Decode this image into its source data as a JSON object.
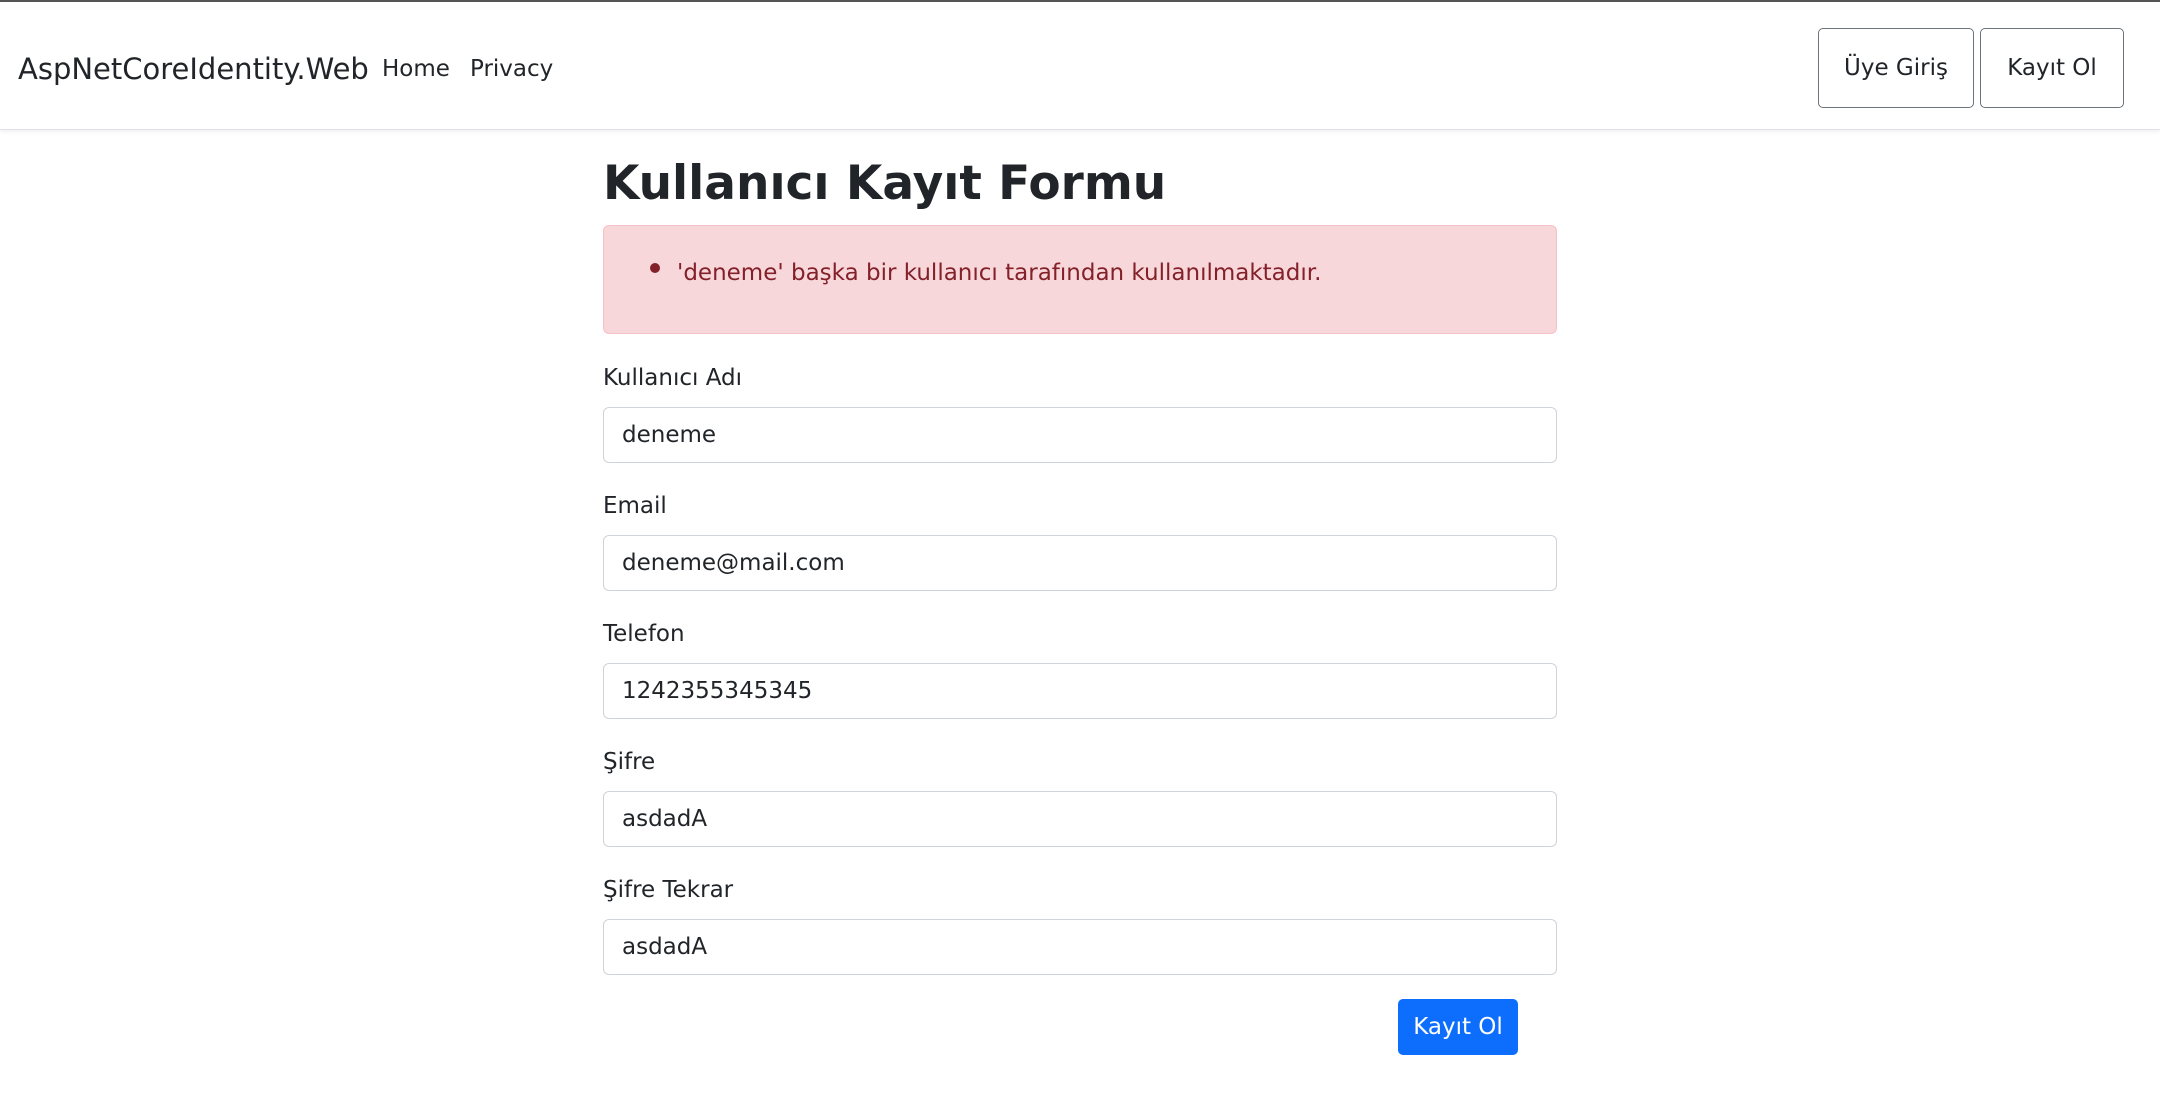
{
  "navbar": {
    "brand": "AspNetCoreIdentity.Web",
    "links": [
      {
        "label": "Home"
      },
      {
        "label": "Privacy"
      }
    ],
    "login_button": "Üye Giriş",
    "register_button": "Kayıt Ol"
  },
  "form": {
    "title": "Kullanıcı Kayıt Formu",
    "errors": [
      "'deneme' başka bir kullanıcı tarafından kullanılmaktadır."
    ],
    "fields": [
      {
        "label": "Kullanıcı Adı",
        "value": "deneme"
      },
      {
        "label": "Email",
        "value": "deneme@mail.com"
      },
      {
        "label": "Telefon",
        "value": "1242355345345"
      },
      {
        "label": "Şifre",
        "value": "asdadA"
      },
      {
        "label": "Şifre Tekrar",
        "value": "asdadA"
      }
    ],
    "submit_label": "Kayıt Ol"
  },
  "colors": {
    "primary": "#0d6efd",
    "alert_background": "#f8d7da",
    "alert_text": "#842029"
  }
}
